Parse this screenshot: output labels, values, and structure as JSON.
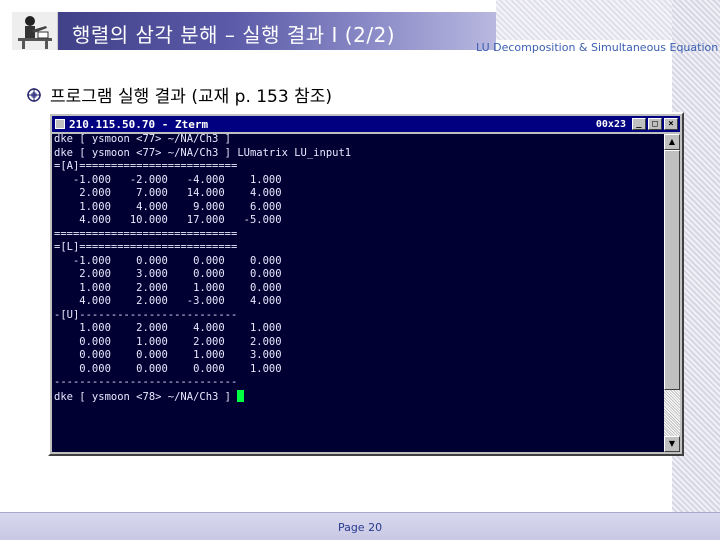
{
  "slide": {
    "title": "행렬의 삼각 분해 – 실행 결과 I (2/2)",
    "subtitle": "LU Decomposition & Simultaneous Equation",
    "bullet": "프로그램 실행 결과 (교재 p. 153 참조)",
    "page_label": "Page 20"
  },
  "xterm": {
    "title": "210.115.50.70 - Zterm",
    "size_label": "00x23",
    "buttons": {
      "minimize": "_",
      "maximize": "□",
      "close": "×"
    },
    "lines": [
      "dke [ ysmoon <77> ~/NA/Ch3 ]",
      "dke [ ysmoon <77> ~/NA/Ch3 ] LUmatrix LU_input1",
      "=[A]=========================",
      "   -1.000   -2.000   -4.000    1.000",
      "    2.000    7.000   14.000    4.000",
      "    1.000    4.000    9.000    6.000",
      "    4.000   10.000   17.000   -5.000",
      "=============================",
      "=[L]=========================",
      "   -1.000    0.000    0.000    0.000",
      "    2.000    3.000    0.000    0.000",
      "    1.000    2.000    1.000    0.000",
      "    4.000    2.000   -3.000    4.000",
      "-[U]-------------------------",
      "    1.000    2.000    4.000    1.000",
      "    0.000    1.000    2.000    2.000",
      "    0.000    0.000    1.000    3.000",
      "    0.000    0.000    0.000    1.000",
      "-----------------------------",
      "dke [ ysmoon <78> ~/NA/Ch3 ] "
    ]
  },
  "icons": {
    "logo": "teacher-at-desk-icon",
    "bullet": "bullet-ornament-icon",
    "terminal": "terminal-app-icon"
  },
  "colors": {
    "title_band_dark": "#3a3a80",
    "terminal_bg": "#000033",
    "terminal_fg": "#e8e8ff",
    "cursor": "#00ff40",
    "titlebar": "#000080",
    "subtitle_text": "#3b5fb0"
  }
}
